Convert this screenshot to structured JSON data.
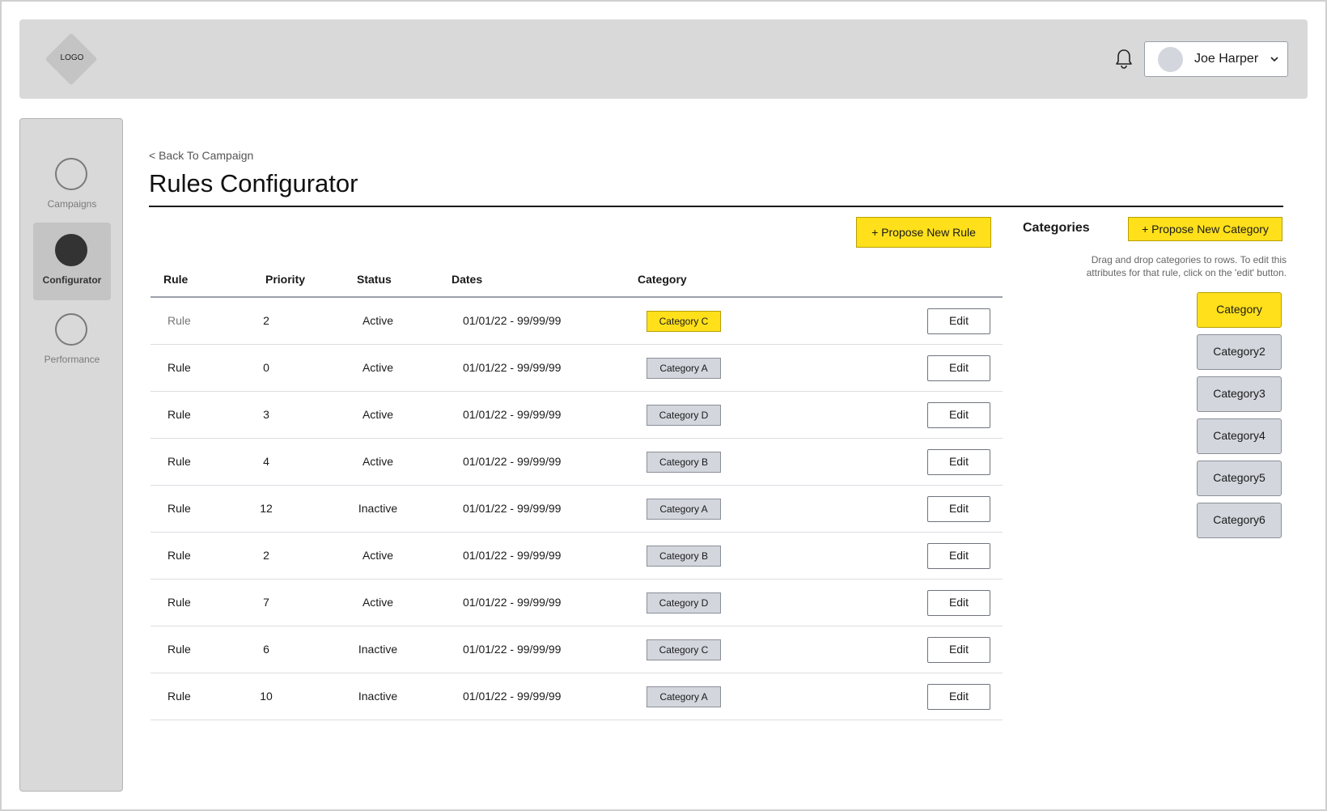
{
  "header": {
    "logo_text": "LOGO",
    "user_name": "Joe Harper"
  },
  "sidebar": {
    "items": [
      {
        "label": "Campaigns",
        "active": false
      },
      {
        "label": "Configurator",
        "active": true
      },
      {
        "label": "Performance",
        "active": false
      }
    ]
  },
  "main": {
    "back_link": "< Back To Campaign",
    "title": "Rules Configurator",
    "propose_rule_label": "+ Propose New Rule",
    "table": {
      "columns": [
        "Rule",
        "Priority",
        "Status",
        "Dates",
        "Category"
      ],
      "edit_label": "Edit",
      "rows": [
        {
          "rule": "Rule",
          "priority": "2",
          "status": "Active",
          "dates": "01/01/22 - 99/99/99",
          "category": "Category C"
        },
        {
          "rule": "Rule",
          "priority": "0",
          "status": "Active",
          "dates": "01/01/22 - 99/99/99",
          "category": "Category A"
        },
        {
          "rule": "Rule",
          "priority": "3",
          "status": "Active",
          "dates": "01/01/22 - 99/99/99",
          "category": "Category D"
        },
        {
          "rule": "Rule",
          "priority": "4",
          "status": "Active",
          "dates": "01/01/22 - 99/99/99",
          "category": "Category B"
        },
        {
          "rule": "Rule",
          "priority": "12",
          "status": "Inactive",
          "dates": "01/01/22 - 99/99/99",
          "category": "Category A"
        },
        {
          "rule": "Rule",
          "priority": "2",
          "status": "Active",
          "dates": "01/01/22 - 99/99/99",
          "category": "Category B"
        },
        {
          "rule": "Rule",
          "priority": "7",
          "status": "Active",
          "dates": "01/01/22 - 99/99/99",
          "category": "Category D"
        },
        {
          "rule": "Rule",
          "priority": "6",
          "status": "Inactive",
          "dates": "01/01/22 - 99/99/99",
          "category": "Category C"
        },
        {
          "rule": "Rule",
          "priority": "10",
          "status": "Inactive",
          "dates": "01/01/22 - 99/99/99",
          "category": "Category A"
        }
      ]
    }
  },
  "categories_panel": {
    "title": "Categories",
    "propose_label": "+ Propose New Category",
    "help_text": "Drag and drop categories to rows. To edit this attributes for that rule, click on the 'edit' button.",
    "items": [
      "Category",
      "Category2",
      "Category3",
      "Category4",
      "Category5",
      "Category6"
    ]
  },
  "colors": {
    "accent_yellow": "#ffe01b",
    "chip_gray": "#d3d6dd",
    "panel_gray": "#d9d9d9"
  },
  "icons": {
    "bell": "bell-icon",
    "chevron": "chevron-down-icon"
  }
}
